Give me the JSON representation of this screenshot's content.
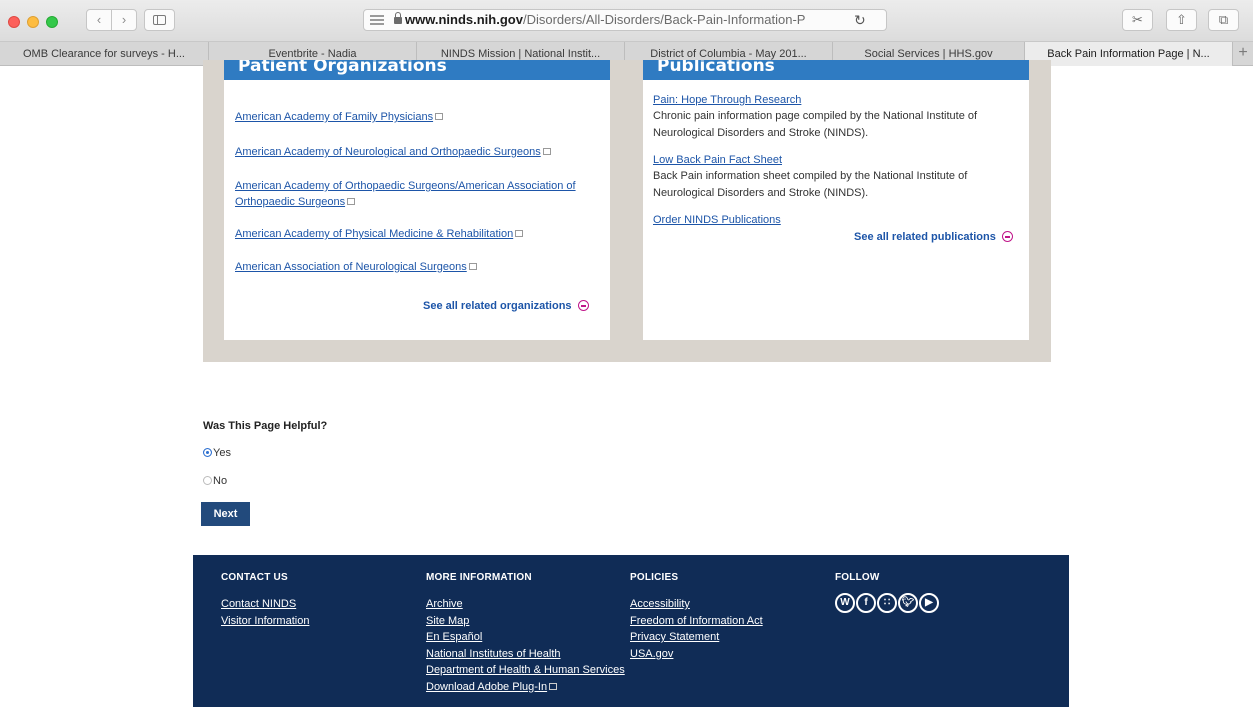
{
  "browser": {
    "url_host": "www.ninds.nih.gov",
    "url_path": "/Disorders/All-Disorders/Back-Pain-Information-P",
    "tabs": [
      {
        "title": "OMB Clearance for surveys - H..."
      },
      {
        "title": "Eventbrite - Nadia"
      },
      {
        "title": "NINDS Mission | National Instit..."
      },
      {
        "title": "District of Columbia - May 201..."
      },
      {
        "title": "Social Services | HHS.gov"
      },
      {
        "title": "Back Pain Information Page | N..."
      }
    ],
    "new_tab": "+"
  },
  "orgs": {
    "heading": "Patient Organizations",
    "links": [
      "American Academy of Family Physicians",
      "American Academy of Neurological and Orthopaedic Surgeons",
      "American Academy of Orthopaedic Surgeons/American Association of",
      "Orthopaedic Surgeons",
      "American Academy of Physical Medicine & Rehabilitation",
      "American Association of Neurological Surgeons"
    ],
    "see_all": "See all related organizations"
  },
  "pubs": {
    "heading": "Publications",
    "items": [
      {
        "link": "Pain: Hope Through Research",
        "desc": "Chronic pain information page compiled by the National Institute of Neurological Disorders and Stroke (NINDS)."
      },
      {
        "link": "Low Back Pain Fact Sheet",
        "desc": "Back Pain information sheet compiled by the National Institute of Neurological Disorders and Stroke (NINDS)."
      }
    ],
    "order": "Order NINDS Publications",
    "see_all": "See all related publications"
  },
  "feedback": {
    "question": "Was This Page Helpful?",
    "yes": "Yes",
    "no": "No",
    "selected": "Yes",
    "next": "Next"
  },
  "footer": {
    "contact": {
      "heading": "CONTACT US",
      "links": [
        "Contact NINDS",
        "Visitor Information"
      ]
    },
    "more": {
      "heading": "MORE INFORMATION",
      "links": [
        "Archive",
        "Site Map",
        "En Español",
        "National Institutes of Health",
        "Department of Health & Human Services",
        "Download Adobe Plug-In"
      ]
    },
    "policies": {
      "heading": "POLICIES",
      "links": [
        "Accessibility",
        "Freedom of Information Act",
        "Privacy Statement",
        "USA.gov"
      ]
    },
    "follow": {
      "heading": "FOLLOW",
      "icons": [
        "wordpress-icon",
        "facebook-icon",
        "rss-icon",
        "twitter-icon",
        "youtube-icon"
      ]
    }
  },
  "colors": {
    "header_blue": "#2f7bc2",
    "link_blue": "#1d55a8",
    "footer_navy": "#102c56",
    "button_navy": "#224a7c",
    "accent_magenta": "#c0168a"
  }
}
